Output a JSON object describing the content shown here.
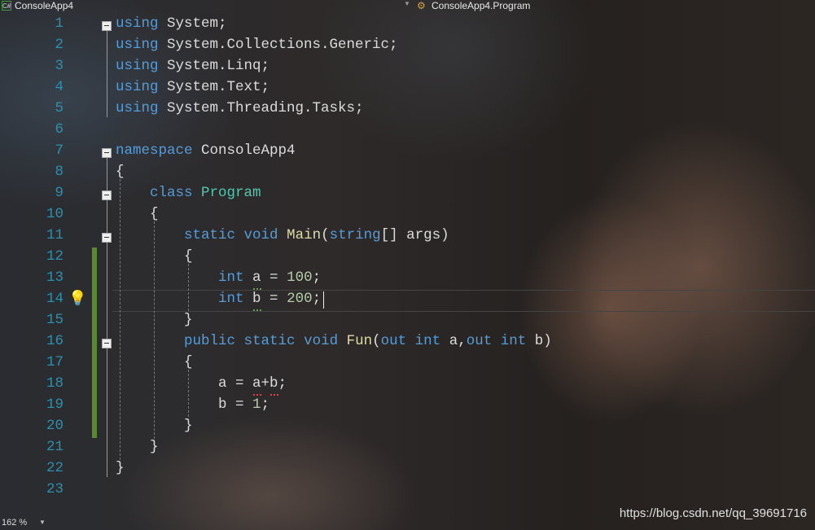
{
  "tab": {
    "project": "ConsoleApp4",
    "project_icon": "csharp-icon",
    "member": "ConsoleApp4.Program",
    "member_icon": "class-icon"
  },
  "editor": {
    "line_numbers": [
      "1",
      "2",
      "3",
      "4",
      "5",
      "6",
      "7",
      "8",
      "9",
      "10",
      "11",
      "12",
      "13",
      "14",
      "15",
      "16",
      "17",
      "18",
      "19",
      "20",
      "21",
      "22",
      "23"
    ],
    "lines": [
      [
        [
          "using",
          "kw"
        ],
        [
          " System;",
          ""
        ]
      ],
      [
        [
          "using",
          "kw"
        ],
        [
          " System.Collections.Generic;",
          ""
        ]
      ],
      [
        [
          "using",
          "kw"
        ],
        [
          " System.Linq;",
          ""
        ]
      ],
      [
        [
          "using",
          "kw"
        ],
        [
          " System.Text;",
          ""
        ]
      ],
      [
        [
          "using",
          "kw"
        ],
        [
          " System.Threading.Tasks;",
          ""
        ]
      ],
      [],
      [
        [
          "namespace",
          "kw"
        ],
        [
          " ConsoleApp4",
          ""
        ]
      ],
      [
        [
          "{",
          ""
        ]
      ],
      [
        [
          "    ",
          ""
        ],
        [
          "class",
          "kw"
        ],
        [
          " ",
          ""
        ],
        [
          "Program",
          "ty"
        ]
      ],
      [
        [
          "    {",
          ""
        ]
      ],
      [
        [
          "        ",
          ""
        ],
        [
          "static",
          "kw"
        ],
        [
          " ",
          ""
        ],
        [
          "void",
          "kw"
        ],
        [
          " ",
          ""
        ],
        [
          "Main",
          "fn"
        ],
        [
          "(",
          ""
        ],
        [
          "string",
          "kw"
        ],
        [
          "[] args)",
          ""
        ]
      ],
      [
        [
          "        {",
          ""
        ]
      ],
      [
        [
          "            ",
          ""
        ],
        [
          "int",
          "kw"
        ],
        [
          " a = ",
          ""
        ],
        [
          "100",
          "num"
        ],
        [
          ";",
          ""
        ]
      ],
      [
        [
          "            ",
          ""
        ],
        [
          "int",
          "kw"
        ],
        [
          " b = ",
          ""
        ],
        [
          "200",
          "num"
        ],
        [
          ";",
          ""
        ]
      ],
      [
        [
          "        }",
          ""
        ]
      ],
      [
        [
          "        ",
          ""
        ],
        [
          "public",
          "kw"
        ],
        [
          " ",
          ""
        ],
        [
          "static",
          "kw"
        ],
        [
          " ",
          ""
        ],
        [
          "void",
          "kw"
        ],
        [
          " ",
          ""
        ],
        [
          "Fun",
          "fn"
        ],
        [
          "(",
          ""
        ],
        [
          "out",
          "kw"
        ],
        [
          " ",
          ""
        ],
        [
          "int",
          "kw"
        ],
        [
          " a,",
          ""
        ],
        [
          "out",
          "kw"
        ],
        [
          " ",
          ""
        ],
        [
          "int",
          "kw"
        ],
        [
          " b)",
          ""
        ]
      ],
      [
        [
          "        {",
          ""
        ]
      ],
      [
        [
          "            a = a+b;",
          ""
        ]
      ],
      [
        [
          "            b = ",
          ""
        ],
        [
          "1",
          "num"
        ],
        [
          ";",
          ""
        ]
      ],
      [
        [
          "        }",
          ""
        ]
      ],
      [
        [
          "    }",
          ""
        ]
      ],
      [
        [
          "}",
          ""
        ]
      ],
      []
    ],
    "current_line": "14",
    "lightbulb_icon": "lightbulb-icon"
  },
  "status": {
    "zoom": "162 %"
  },
  "watermark": "https://blog.csdn.net/qq_39691716"
}
